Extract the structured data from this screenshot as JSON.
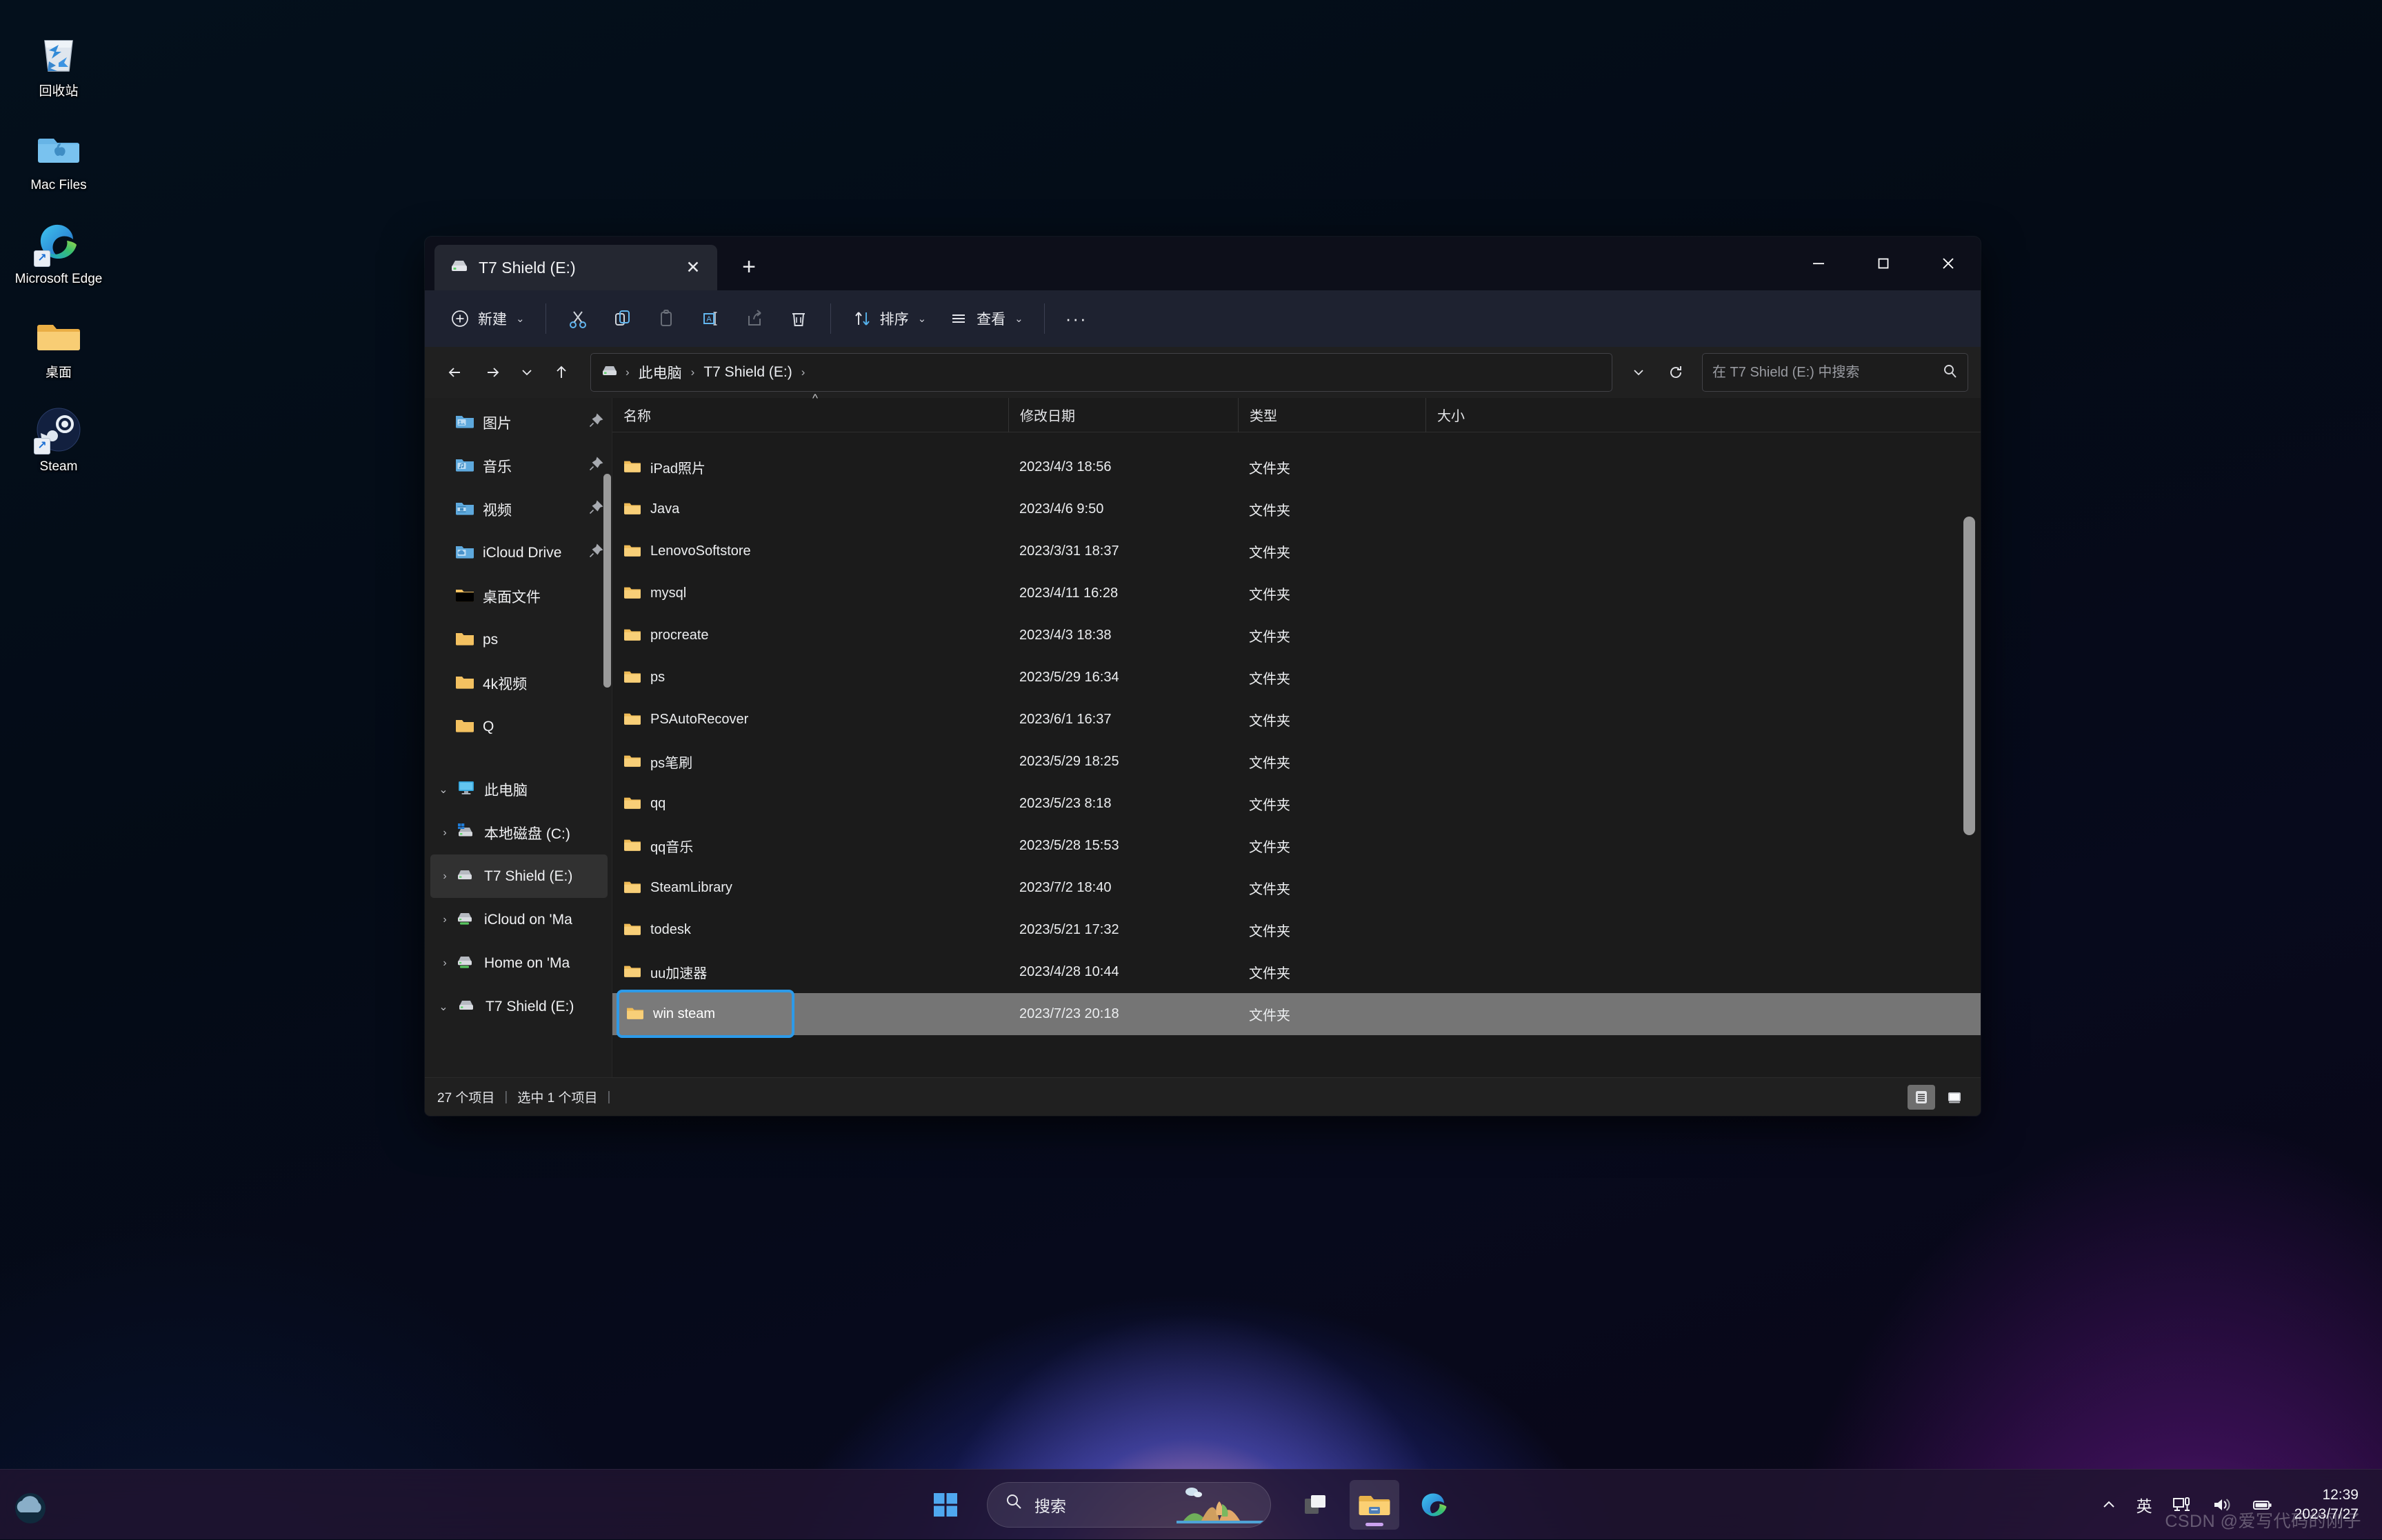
{
  "desktop": {
    "icons": [
      {
        "label": "回收站",
        "icon": "recycle-bin-icon"
      },
      {
        "label": "Mac Files",
        "icon": "mac-folder-icon"
      },
      {
        "label": "Microsoft Edge",
        "icon": "edge-icon",
        "shortcut": true
      },
      {
        "label": "桌面",
        "icon": "folder-icon"
      },
      {
        "label": "Steam",
        "icon": "steam-icon",
        "shortcut": true
      }
    ]
  },
  "explorer": {
    "tab": {
      "title": "T7 Shield (E:)",
      "icon": "drive-icon",
      "close_label": "✕"
    },
    "new_tab_label": "+",
    "window_controls": {
      "minimize": "—",
      "maximize": "▢",
      "close": "✕"
    },
    "toolbar": {
      "new_label": "新建",
      "buttons": [
        {
          "name": "cut",
          "icon": "scissors-icon",
          "disabled": false
        },
        {
          "name": "copy",
          "icon": "copy-icon",
          "disabled": false
        },
        {
          "name": "paste",
          "icon": "paste-icon",
          "disabled": true
        },
        {
          "name": "rename",
          "icon": "rename-icon",
          "disabled": false
        },
        {
          "name": "share",
          "icon": "share-icon",
          "disabled": true
        },
        {
          "name": "delete",
          "icon": "trash-icon",
          "disabled": false
        }
      ],
      "sort_label": "排序",
      "view_label": "查看",
      "more_label": "···"
    },
    "address": {
      "back_icon": "arrow-left-icon",
      "forward_icon": "arrow-right-icon",
      "recent_icon": "chevron-down-icon",
      "up_icon": "arrow-up-icon",
      "crumbs": [
        "此电脑",
        "T7 Shield (E:)"
      ],
      "crumb_sep": "›",
      "dropdown_icon": "chevron-down-icon",
      "refresh_icon": "refresh-icon"
    },
    "search": {
      "placeholder": "在 T7 Shield (E:) 中搜索",
      "value": "",
      "icon": "search-icon"
    },
    "sidebar": {
      "quick_access": [
        {
          "label": "图片",
          "icon": "pictures-folder-icon",
          "pinned": true
        },
        {
          "label": "音乐",
          "icon": "music-folder-icon",
          "pinned": true
        },
        {
          "label": "视频",
          "icon": "videos-folder-icon",
          "pinned": true
        },
        {
          "label": "iCloud Drive",
          "icon": "icloud-folder-icon",
          "pinned": true
        },
        {
          "label": "桌面文件",
          "icon": "folder-icon",
          "pinned": false
        },
        {
          "label": "ps",
          "icon": "folder-icon",
          "pinned": false
        },
        {
          "label": "4k视频",
          "icon": "folder-icon",
          "pinned": false
        },
        {
          "label": "Q",
          "icon": "folder-icon",
          "pinned": false
        }
      ],
      "this_pc": {
        "label": "此电脑",
        "icon": "this-pc-icon",
        "expanded": true
      },
      "drives": [
        {
          "label": "本地磁盘 (C:)",
          "icon": "windows-drive-icon",
          "selected": false
        },
        {
          "label": "T7 Shield (E:)",
          "icon": "drive-icon",
          "selected": true
        },
        {
          "label": "iCloud on 'Ma",
          "icon": "network-drive-icon",
          "selected": false
        },
        {
          "label": "Home on 'Ma",
          "icon": "network-drive-icon",
          "selected": false
        }
      ],
      "bottom": {
        "label": "T7 Shield (E:)",
        "icon": "drive-icon",
        "expanded": true
      }
    },
    "columns": [
      {
        "key": "name",
        "label": "名称",
        "sorted": true
      },
      {
        "key": "date",
        "label": "修改日期"
      },
      {
        "key": "type",
        "label": "类型"
      },
      {
        "key": "size",
        "label": "大小"
      }
    ],
    "files": [
      {
        "name": "iPad照片",
        "date": "2023/4/3 18:56",
        "type": "文件夹",
        "size": ""
      },
      {
        "name": "Java",
        "date": "2023/4/6 9:50",
        "type": "文件夹",
        "size": ""
      },
      {
        "name": "LenovoSoftstore",
        "date": "2023/3/31 18:37",
        "type": "文件夹",
        "size": ""
      },
      {
        "name": "mysql",
        "date": "2023/4/11 16:28",
        "type": "文件夹",
        "size": ""
      },
      {
        "name": "procreate",
        "date": "2023/4/3 18:38",
        "type": "文件夹",
        "size": ""
      },
      {
        "name": "ps",
        "date": "2023/5/29 16:34",
        "type": "文件夹",
        "size": ""
      },
      {
        "name": "PSAutoRecover",
        "date": "2023/6/1 16:37",
        "type": "文件夹",
        "size": ""
      },
      {
        "name": "ps笔刷",
        "date": "2023/5/29 18:25",
        "type": "文件夹",
        "size": ""
      },
      {
        "name": "qq",
        "date": "2023/5/23 8:18",
        "type": "文件夹",
        "size": ""
      },
      {
        "name": "qq音乐",
        "date": "2023/5/28 15:53",
        "type": "文件夹",
        "size": ""
      },
      {
        "name": "SteamLibrary",
        "date": "2023/7/2 18:40",
        "type": "文件夹",
        "size": ""
      },
      {
        "name": "todesk",
        "date": "2023/5/21 17:32",
        "type": "文件夹",
        "size": ""
      },
      {
        "name": "uu加速器",
        "date": "2023/4/28 10:44",
        "type": "文件夹",
        "size": ""
      }
    ],
    "selected_row": {
      "name": "win steam",
      "date": "2023/7/23 20:18",
      "type": "文件夹",
      "size": "",
      "renaming": true
    },
    "status": {
      "item_count": "27 个项目",
      "selection": "选中 1 个项目",
      "separator": "|",
      "details_view_icon": "details-view-icon",
      "large_icons_view_icon": "large-icons-view-icon"
    }
  },
  "taskbar": {
    "start_icon": "windows-start-icon",
    "search": {
      "placeholder": "搜索",
      "icon": "search-icon"
    },
    "apps": [
      {
        "name": "task-view",
        "icon": "task-view-icon",
        "active": false
      },
      {
        "name": "file-explorer",
        "icon": "file-explorer-icon",
        "active": true
      },
      {
        "name": "microsoft-edge",
        "icon": "edge-icon",
        "active": false
      }
    ],
    "tray": {
      "overflow_icon": "chevron-up-icon",
      "ime_label": "英",
      "network_icon": "network-icon",
      "volume_icon": "volume-icon",
      "battery_icon": "battery-icon"
    },
    "clock": {
      "time": "12:39",
      "date": "2023/7/27"
    }
  },
  "watermark": "CSDN @爱写代码的刚子",
  "colors": {
    "accent": "#2d9ae8",
    "folder": "#f7c768",
    "selection": "#757575",
    "window_bg": "#1e1e1e",
    "toolbar_bg": "#1e2230",
    "titlebar_bg": "#0d0f1a"
  }
}
